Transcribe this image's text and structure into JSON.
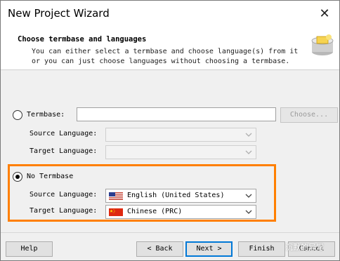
{
  "window": {
    "title": "New Project Wizard"
  },
  "header": {
    "title": "Choose termbase and languages",
    "desc_line1": "You can either select a termbase and choose language(s) from it",
    "desc_line2": "or you can just choose languages without choosing a termbase."
  },
  "termbase_option": {
    "label": "Termbase:",
    "path_value": "",
    "choose_label": "Choose...",
    "source_label": "Source Language:",
    "target_label": "Target Language:",
    "source_value": "",
    "target_value": ""
  },
  "no_termbase_option": {
    "label": "No Termbase",
    "selected": true,
    "source_label": "Source Language:",
    "target_label": "Target Language:",
    "source_value": "English (United States)",
    "target_value": "Chinese (PRC)"
  },
  "footer": {
    "help": "Help",
    "back": "< Back",
    "next": "Next >",
    "finish": "Finish",
    "cancel": "Cancel"
  },
  "watermark_text": "沉默的异常",
  "colors": {
    "highlight": "#ff7f00",
    "default_button_border": "#0078d7"
  }
}
